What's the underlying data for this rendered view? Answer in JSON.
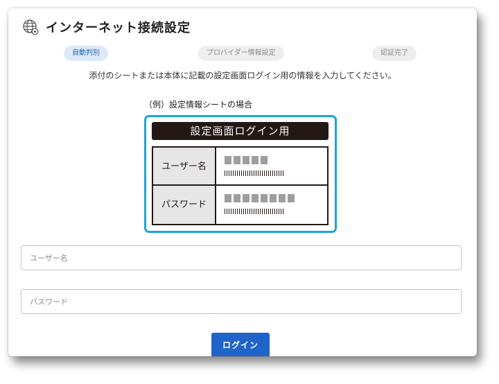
{
  "header": {
    "title": "インターネット接続設定",
    "icon": "globe-settings-icon"
  },
  "steps": [
    {
      "label": "自動判別",
      "active": true
    },
    {
      "label": "プロバイダー情報設定",
      "active": false
    },
    {
      "label": "認証完了",
      "active": false
    }
  ],
  "instruction": "添付のシートまたは本体に記載の設定画面ログイン用の情報を入力してください。",
  "example": {
    "caption": "（例）設定情報シートの場合",
    "sheet_title": "設定画面ログイン用",
    "rows": [
      {
        "label": "ユーザー名",
        "masked_chars": 5
      },
      {
        "label": "パスワード",
        "masked_chars": 8
      }
    ]
  },
  "form": {
    "username_placeholder": "ユーザー名",
    "username_value": "",
    "password_placeholder": "パスワード",
    "password_value": "",
    "login_label": "ログイン"
  },
  "colors": {
    "accent": "#1f64c8",
    "sheet_border": "#1aa5db",
    "active_step_bg": "#dde9f6",
    "active_step_text": "#1f64b5"
  }
}
